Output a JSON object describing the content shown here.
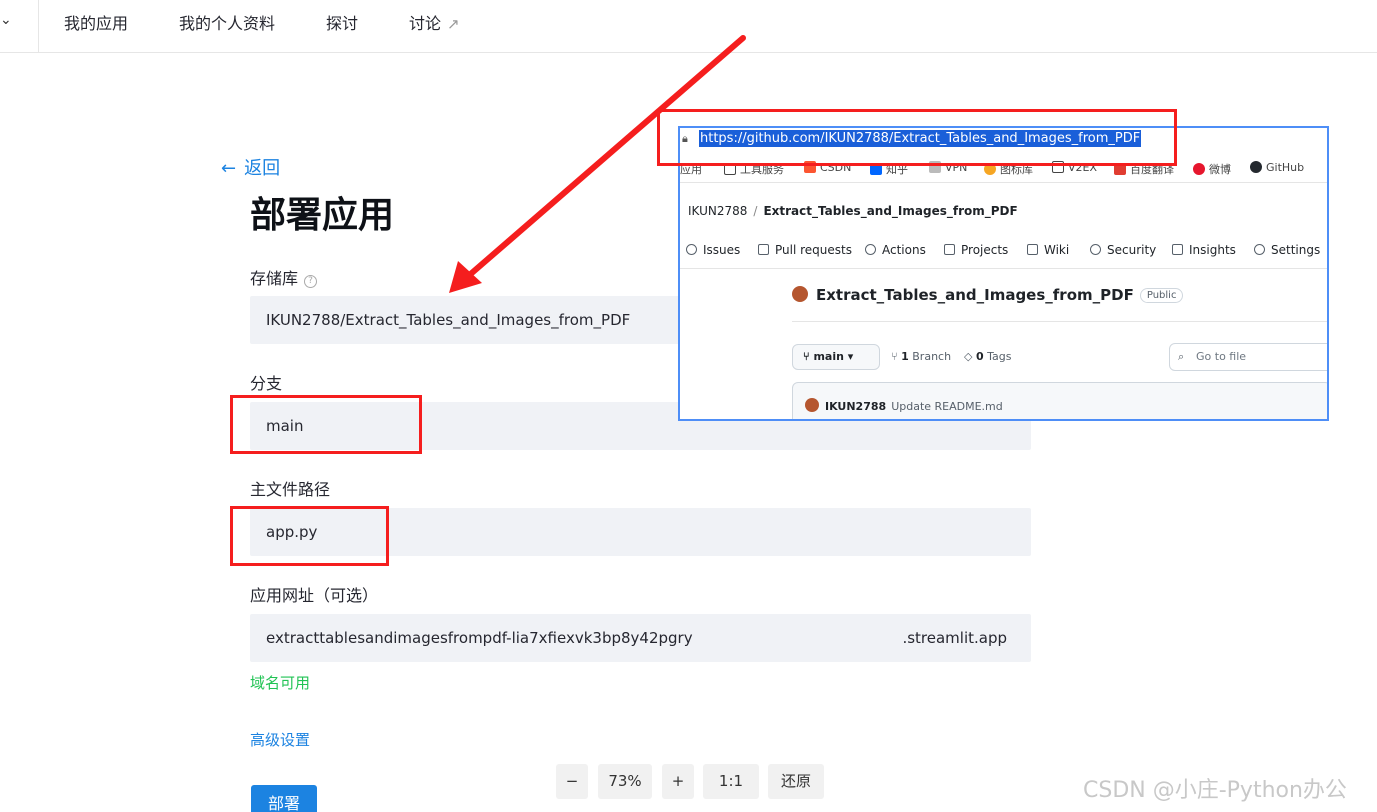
{
  "nav": {
    "items": [
      "我的应用",
      "我的个人资料",
      "探讨",
      "讨论"
    ],
    "ext_icon": "↗"
  },
  "form": {
    "back_label": "返回",
    "title": "部署应用",
    "repo_label": "存储库",
    "repo_value": "IKUN2788/Extract_Tables_and_Images_from_PDF",
    "branch_label": "分支",
    "branch_value": "main",
    "main_file_label": "主文件路径",
    "main_file_value": "app.py",
    "url_label": "应用网址（可选）",
    "url_value": "extracttablesandimagesfrompdf-lia7xfiexvk3bp8y42pgry",
    "url_suffix": ".streamlit.app",
    "domain_status": "域名可用",
    "advanced_label": "高级设置",
    "deploy_label": "部署"
  },
  "inset": {
    "url": "https://github.com/IKUN2788/Extract_Tables_and_Images_from_PDF",
    "bookmarks": [
      "应用",
      "工具服务",
      "CSDN",
      "知乎",
      "VPN",
      "图标库",
      "V2EX",
      "百度翻译",
      "微博",
      "GitHub"
    ],
    "breadcrumb_owner": "IKUN2788",
    "breadcrumb_repo": "Extract_Tables_and_Images_from_PDF",
    "tabs": [
      "Issues",
      "Pull requests",
      "Actions",
      "Projects",
      "Wiki",
      "Security",
      "Insights",
      "Settings"
    ],
    "repo_title": "Extract_Tables_and_Images_from_PDF",
    "public_badge": "Public",
    "branch_button": "main",
    "branch_count": "1",
    "branch_word": "Branch",
    "tag_count": "0",
    "tag_word": "Tags",
    "goto_placeholder": "Go to file",
    "commit_author": "IKUN2788",
    "commit_message": "Update README.md"
  },
  "zoom": {
    "minus": "−",
    "level": "73%",
    "plus": "+",
    "one_to_one": "1:1",
    "restore": "还原"
  },
  "watermark": "CSDN @小庄-Python办公",
  "colors": {
    "accent": "#1c83e1",
    "success": "#21c354",
    "annotation": "#f51e1e",
    "field_bg": "#f0f2f6"
  }
}
